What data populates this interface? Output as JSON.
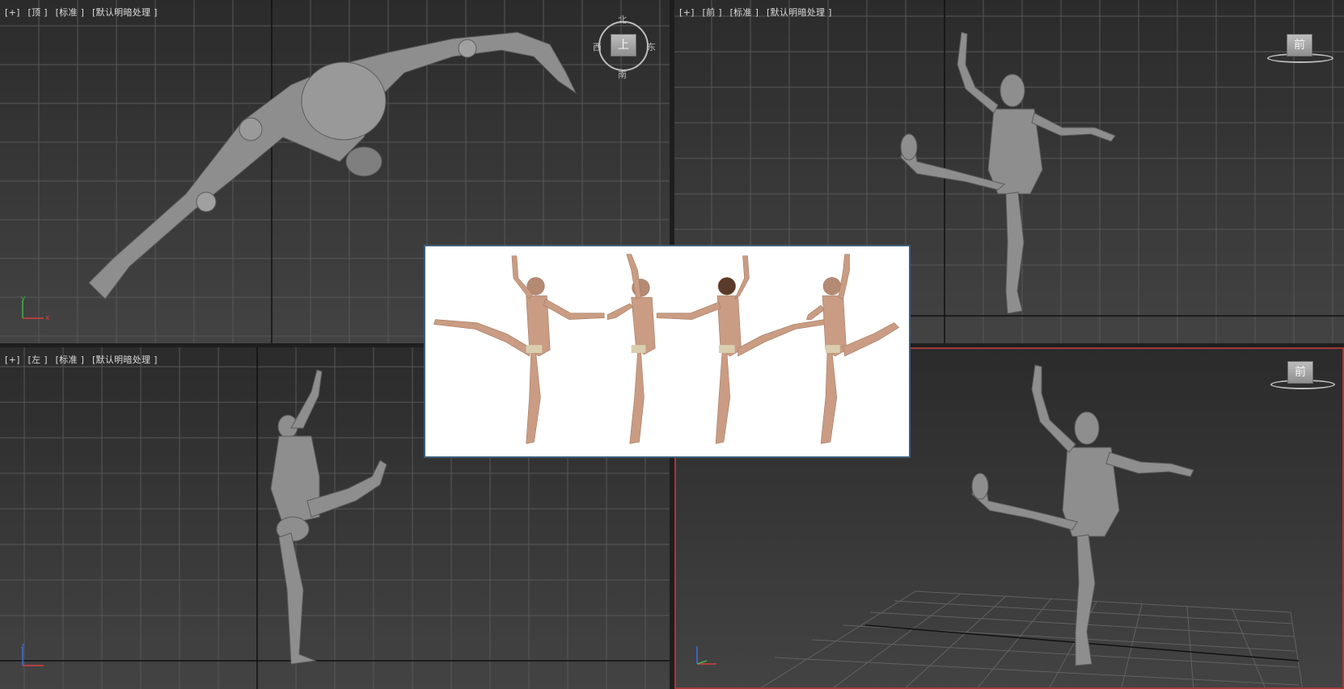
{
  "viewports": {
    "top": {
      "label": [
        "[+]",
        "[顶 ]",
        "[标准 ]",
        "[默认明暗处理 ]"
      ]
    },
    "front": {
      "label": [
        "[+]",
        "[前 ]",
        "[标准 ]",
        "[默认明暗处理 ]"
      ]
    },
    "left": {
      "label": [
        "[+]",
        "[左 ]",
        "[标准 ]",
        "[默认明暗处理 ]"
      ]
    },
    "perspective": {
      "label": []
    }
  },
  "viewcube": {
    "top_face": "上",
    "front_face": "前",
    "perspective_face": "前",
    "compass": {
      "north": "北",
      "south": "南",
      "east": "东",
      "west": "西"
    }
  },
  "axes": {
    "x": "x",
    "y": "y",
    "z": "z"
  },
  "colors": {
    "viewport_bg_top": "#2b2b2b",
    "viewport_bg_bottom": "#434343",
    "grid": "#5a5a5a",
    "active_border": "#a33a3a",
    "mannequin": "#8e8e8e",
    "reference_border": "#3c5e7a"
  },
  "reference_panel": {
    "icon": "reference-photo",
    "views": 4
  }
}
